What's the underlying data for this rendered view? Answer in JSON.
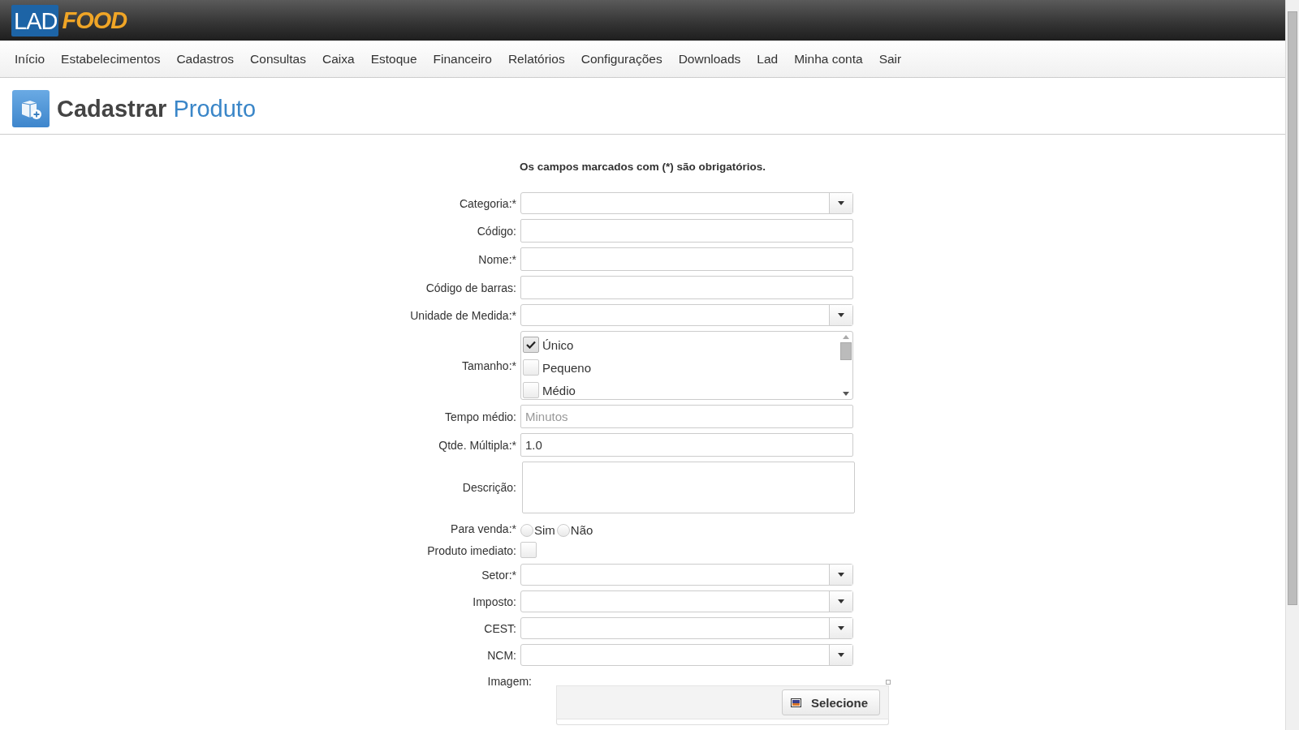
{
  "header": {
    "logo_left": "LAD",
    "logo_right": "FOOD"
  },
  "nav": [
    "Início",
    "Estabelecimentos",
    "Cadastros",
    "Consultas",
    "Caixa",
    "Estoque",
    "Financeiro",
    "Relatórios",
    "Configurações",
    "Downloads",
    "Lad",
    "Minha conta",
    "Sair"
  ],
  "page_title": {
    "verb": "Cadastrar",
    "object": "Produto"
  },
  "form": {
    "notice": "Os campos marcados com (*) são obrigatórios.",
    "fields": [
      {
        "kind": "select",
        "label": "Categoria:*"
      },
      {
        "kind": "text",
        "label": "Código:"
      },
      {
        "kind": "text",
        "label": "Nome:*"
      },
      {
        "kind": "text",
        "label": "Código de barras:"
      },
      {
        "kind": "select",
        "label": "Unidade de Medida:*"
      },
      {
        "kind": "checklist",
        "label": "Tamanho:*",
        "options": [
          {
            "label": "Único",
            "checked": true
          },
          {
            "label": "Pequeno",
            "checked": false
          },
          {
            "label": "Médio",
            "checked": false
          }
        ]
      },
      {
        "kind": "text",
        "label": "Tempo médio:",
        "placeholder": "Minutos"
      },
      {
        "kind": "text",
        "label": "Qtde. Múltipla:*",
        "value": "1.0"
      },
      {
        "kind": "textarea",
        "label": "Descrição:"
      },
      {
        "kind": "radio",
        "label": "Para venda:*",
        "options": [
          {
            "label": "Sim",
            "selected": false
          },
          {
            "label": "Não",
            "selected": false
          }
        ]
      },
      {
        "kind": "checkbox",
        "label": "Produto imediato:",
        "checked": false
      },
      {
        "kind": "select",
        "label": "Setor:*"
      },
      {
        "kind": "select",
        "label": "Imposto:"
      },
      {
        "kind": "select",
        "label": "CEST:"
      },
      {
        "kind": "select",
        "label": "NCM:"
      },
      {
        "kind": "file",
        "label": "Imagem:",
        "button": "Selecione"
      }
    ]
  }
}
